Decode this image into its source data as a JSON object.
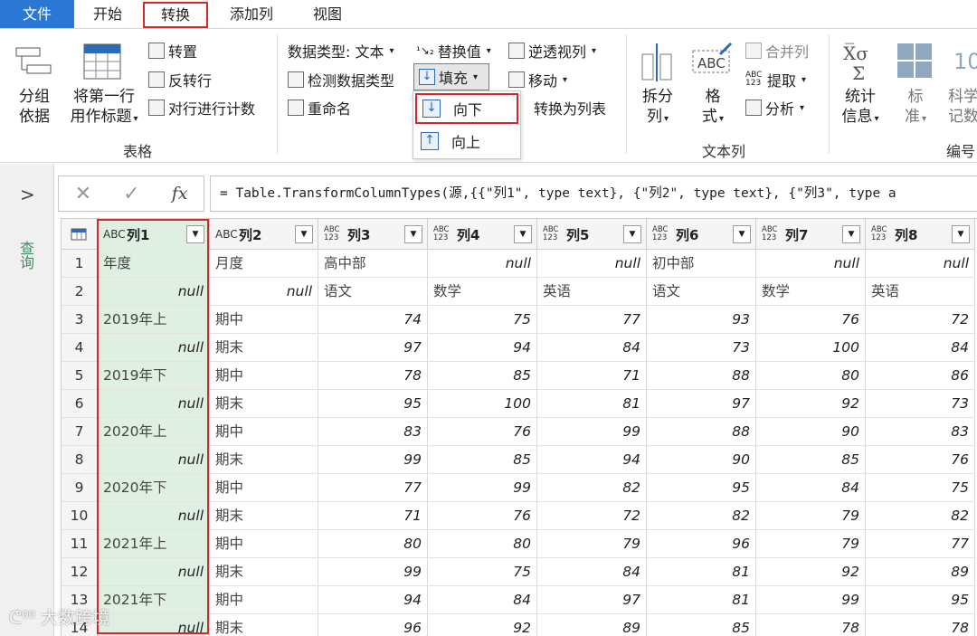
{
  "tabs": {
    "file": "文件",
    "home": "开始",
    "transform": "转换",
    "add_column": "添加列",
    "view": "视图"
  },
  "ribbon": {
    "group_by_l1": "分组",
    "group_by_l2": "依据",
    "first_row_l1": "将第一行",
    "first_row_l2": "用作标题",
    "transpose": "转置",
    "reverse_rows": "反转行",
    "count_rows": "对行进行计数",
    "table_group": "表格",
    "data_type": "数据类型: 文本",
    "detect_type": "检测数据类型",
    "rename": "重命名",
    "replace_values": "替换值",
    "fill": "填充",
    "unpivot": "逆透视列",
    "move": "移动",
    "to_list": "转换为列表",
    "split_l1": "拆分",
    "split_l2": "列",
    "format_l1": "格",
    "format_l2": "式",
    "merge": "合并列",
    "extract": "提取",
    "parse": "分析",
    "text_group": "文本列",
    "stats_l1": "统计",
    "stats_l2": "信息",
    "std_l1": "标",
    "std_l2": "准",
    "sci_l1": "科学",
    "sci_l2": "记数",
    "sci_icon": "10",
    "num_group": "编号"
  },
  "fill_menu": {
    "down": "向下",
    "up": "向上"
  },
  "left_pane": {
    "label": "查询"
  },
  "formula": "= Table.TransformColumnTypes(源,{{\"列1\", type text}, {\"列2\", type text}, {\"列3\", type a",
  "grid": {
    "columns": [
      {
        "name": "列1",
        "type": "ABC"
      },
      {
        "name": "列2",
        "type": "ABC"
      },
      {
        "name": "列3",
        "type": "ABC 123"
      },
      {
        "name": "列4",
        "type": "ABC 123"
      },
      {
        "name": "列5",
        "type": "ABC 123"
      },
      {
        "name": "列6",
        "type": "ABC 123"
      },
      {
        "name": "列7",
        "type": "ABC 123"
      },
      {
        "name": "列8",
        "type": "ABC 123"
      }
    ],
    "rows": [
      [
        "1",
        "年度",
        "月度",
        "高中部",
        "null",
        "null",
        "初中部",
        "null",
        "null"
      ],
      [
        "2",
        "null",
        "null",
        "语文",
        "数学",
        "英语",
        "语文",
        "数学",
        "英语"
      ],
      [
        "3",
        "2019年上",
        "期中",
        "74",
        "75",
        "77",
        "93",
        "76",
        "72"
      ],
      [
        "4",
        "null",
        "期末",
        "97",
        "94",
        "84",
        "73",
        "100",
        "84"
      ],
      [
        "5",
        "2019年下",
        "期中",
        "78",
        "85",
        "71",
        "88",
        "80",
        "86"
      ],
      [
        "6",
        "null",
        "期末",
        "95",
        "100",
        "81",
        "97",
        "92",
        "73"
      ],
      [
        "7",
        "2020年上",
        "期中",
        "83",
        "76",
        "99",
        "88",
        "90",
        "83"
      ],
      [
        "8",
        "null",
        "期末",
        "99",
        "85",
        "94",
        "90",
        "85",
        "76"
      ],
      [
        "9",
        "2020年下",
        "期中",
        "77",
        "99",
        "82",
        "95",
        "84",
        "75"
      ],
      [
        "10",
        "null",
        "期末",
        "71",
        "76",
        "72",
        "82",
        "79",
        "82"
      ],
      [
        "11",
        "2021年上",
        "期中",
        "80",
        "80",
        "79",
        "96",
        "79",
        "77"
      ],
      [
        "12",
        "null",
        "期末",
        "99",
        "75",
        "84",
        "81",
        "92",
        "89"
      ],
      [
        "13",
        "2021年下",
        "期中",
        "94",
        "84",
        "97",
        "81",
        "99",
        "95"
      ],
      [
        "14",
        "null",
        "期末",
        "96",
        "92",
        "89",
        "85",
        "78",
        "78"
      ]
    ]
  },
  "watermark": "大数跨境"
}
